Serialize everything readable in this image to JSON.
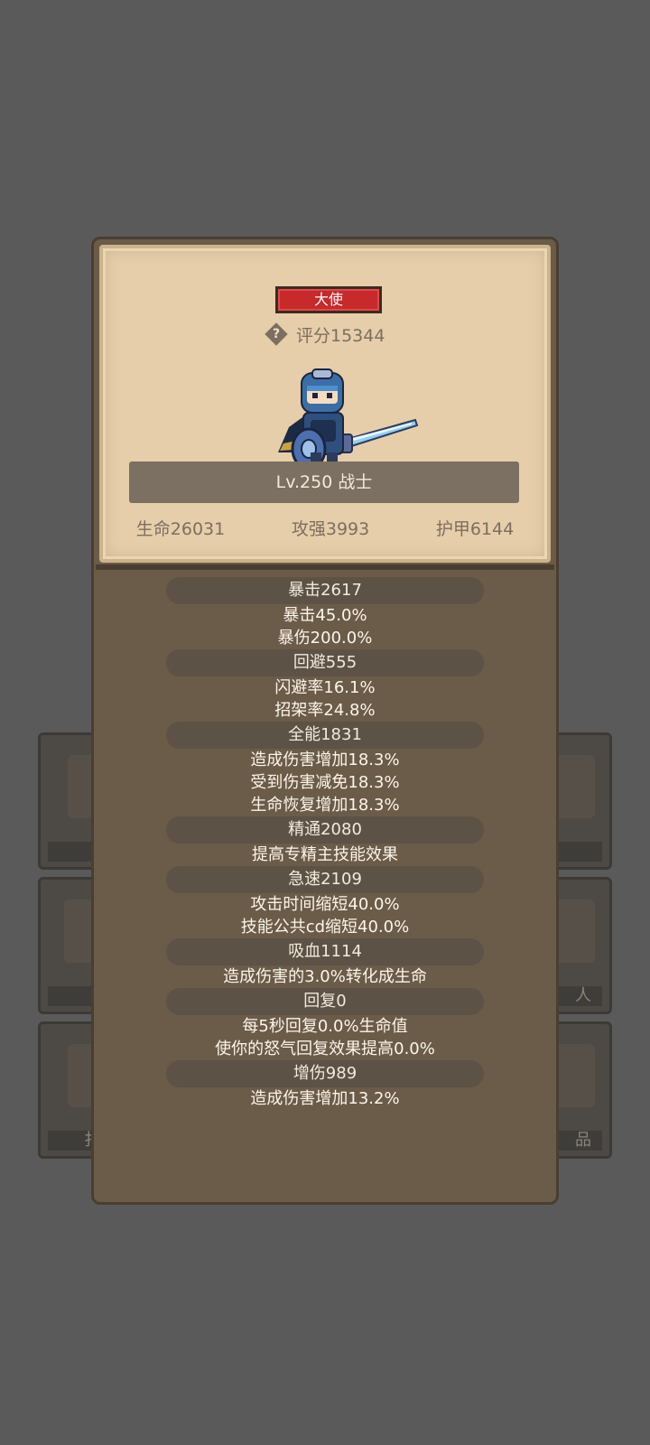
{
  "background": {
    "tiles": [
      {
        "label": ""
      },
      {
        "label": ""
      },
      {
        "label": "扌"
      },
      {
        "label": ""
      },
      {
        "label": "人"
      },
      {
        "label": "品"
      }
    ]
  },
  "card": {
    "title_badge": "大使",
    "score": "评分15344",
    "level": "Lv.250 战士",
    "stats": {
      "hp": "生命26031",
      "attack": "攻强3993",
      "armor": "护甲6144"
    }
  },
  "attributes": [
    {
      "header": "暴击2617",
      "lines": [
        "暴击45.0%",
        "暴伤200.0%"
      ]
    },
    {
      "header": "回避555",
      "lines": [
        "闪避率16.1%",
        "招架率24.8%"
      ]
    },
    {
      "header": "全能1831",
      "lines": [
        "造成伤害增加18.3%",
        "受到伤害减免18.3%",
        "生命恢复增加18.3%"
      ]
    },
    {
      "header": "精通2080",
      "lines": [
        "提高专精主技能效果"
      ]
    },
    {
      "header": "急速2109",
      "lines": [
        "攻击时间缩短40.0%",
        "技能公共cd缩短40.0%"
      ]
    },
    {
      "header": "吸血1114",
      "lines": [
        "造成伤害的3.0%转化成生命"
      ]
    },
    {
      "header": "回复0",
      "lines": [
        "每5秒回复0.0%生命值",
        "使你的怒气回复效果提高0.0%"
      ]
    },
    {
      "header": "增伤989",
      "lines": [
        "造成伤害增加13.2%"
      ]
    }
  ],
  "colors": {
    "overlay": "#5a5a5a",
    "panel": "#6b5b49",
    "card": "#e6ceaa",
    "badge": "#c8292b",
    "pill": "#5d5246"
  },
  "icons": {
    "help": "help-diamond-icon",
    "hero": "warrior-character-icon"
  }
}
